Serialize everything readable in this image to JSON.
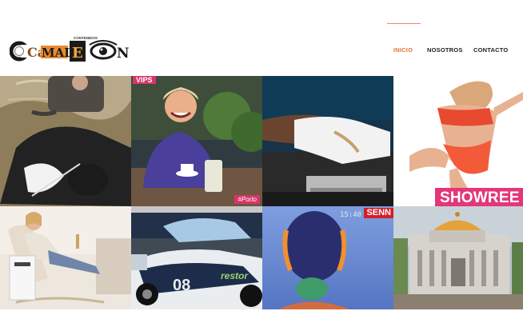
{
  "brand": {
    "logo_top_text": "CONTENIDOS",
    "logo_text_left": "Ca",
    "logo_text_mid": "MAL",
    "logo_text_e": "E",
    "logo_text_right": "N",
    "logo_alt": "Camaleon Contenidos"
  },
  "nav": {
    "items": [
      {
        "label": "INICIO",
        "active": true
      },
      {
        "label": "NOSOTROS",
        "active": false
      },
      {
        "label": "CONTACTO",
        "active": false
      }
    ],
    "active_color": "#e9703a"
  },
  "tiles": {
    "t1": {
      "name": "cow-farmer"
    },
    "t2": {
      "name": "woman-coffee",
      "badge_top": "VIPS",
      "badge_bottom": "#Porto"
    },
    "t3": {
      "name": "sprinter-start"
    },
    "t4": {
      "name": "showreel",
      "label": "SHOWREE"
    },
    "t5": {
      "name": "woman-rocking-chair"
    },
    "t6": {
      "name": "race-car",
      "car_number": "08",
      "sponsor": "restor"
    },
    "t7": {
      "name": "puppet-tv",
      "clock": "15:40",
      "brand": "SENN"
    },
    "t8": {
      "name": "bellas-artes"
    }
  },
  "colors": {
    "accent": "#e9703a",
    "pink": "#e23779"
  }
}
